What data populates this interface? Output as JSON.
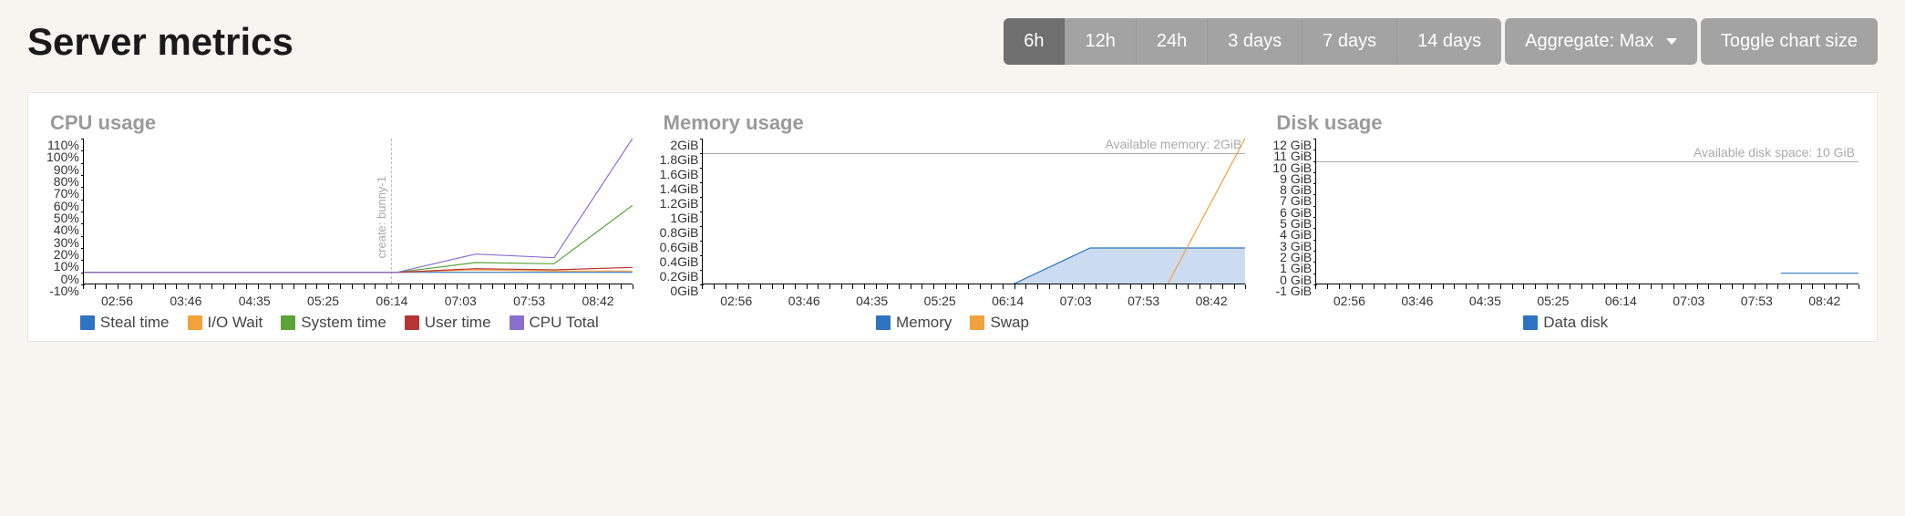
{
  "page_title": "Server metrics",
  "time_buttons": [
    "6h",
    "12h",
    "24h",
    "3 days",
    "7 days",
    "14 days"
  ],
  "time_active": "6h",
  "aggregate_label": "Aggregate: Max",
  "toggle_label": "Toggle chart size",
  "x_ticks": [
    "02:56",
    "03:46",
    "04:35",
    "05:25",
    "06:14",
    "07:03",
    "07:53",
    "08:42"
  ],
  "chart_data": [
    {
      "id": "cpu",
      "type": "line",
      "title": "CPU usage",
      "xlabel": "",
      "ylabel": "%",
      "ylim": [
        -10,
        110
      ],
      "y_ticks": [
        -10,
        0,
        10,
        20,
        30,
        40,
        50,
        60,
        70,
        80,
        90,
        100,
        110
      ],
      "y_tick_format": "%",
      "x": [
        "02:56",
        "03:46",
        "04:35",
        "05:25",
        "06:14",
        "07:03",
        "07:53",
        "08:42"
      ],
      "annotations": [
        {
          "type": "vline",
          "x": "06:30",
          "label": "create: bunny-1"
        }
      ],
      "series": [
        {
          "name": "Steal time",
          "color": "#2f74c2",
          "values": [
            0,
            0,
            0,
            0,
            0,
            0,
            0,
            0
          ]
        },
        {
          "name": "I/O Wait",
          "color": "#f2a13c",
          "values": [
            0,
            0,
            0,
            0,
            0,
            2,
            1,
            1
          ]
        },
        {
          "name": "System time",
          "color": "#5aa43a",
          "values": [
            0,
            0,
            0,
            0,
            0,
            8,
            7,
            55
          ]
        },
        {
          "name": "User time",
          "color": "#b83535",
          "values": [
            0,
            0,
            0,
            0,
            0,
            3,
            2,
            4
          ]
        },
        {
          "name": "CPU Total",
          "color": "#8b6fcf",
          "values": [
            0,
            0,
            0,
            0,
            0,
            15,
            12,
            110
          ]
        }
      ]
    },
    {
      "id": "mem",
      "type": "area",
      "title": "Memory usage",
      "xlabel": "",
      "ylabel": "GiB",
      "ylim": [
        0,
        2.0
      ],
      "y_ticks": [
        0,
        0.2,
        0.4,
        0.6,
        0.8,
        1.0,
        1.2,
        1.4,
        1.6,
        1.8,
        2.0
      ],
      "y_tick_format": "GiB",
      "x": [
        "02:56",
        "03:46",
        "04:35",
        "05:25",
        "06:14",
        "07:03",
        "07:53",
        "08:42"
      ],
      "annotations": [
        {
          "type": "hline",
          "y": 1.8,
          "label": "Available memory: 2GiB"
        }
      ],
      "series": [
        {
          "name": "Memory",
          "color": "#2f74c2",
          "fill": true,
          "values": [
            0,
            0,
            0,
            0,
            0,
            0.5,
            0.5,
            0.5
          ]
        },
        {
          "name": "Swap",
          "color": "#f2a13c",
          "fill": false,
          "values": [
            0,
            0,
            0,
            0,
            0,
            0,
            0,
            2.0
          ]
        }
      ]
    },
    {
      "id": "disk",
      "type": "line",
      "title": "Disk usage",
      "xlabel": "",
      "ylabel": "GiB",
      "ylim": [
        -1,
        12
      ],
      "y_ticks": [
        -1,
        0,
        1,
        2,
        3,
        4,
        5,
        6,
        7,
        8,
        9,
        10,
        11,
        12
      ],
      "y_tick_format": " GiB",
      "x": [
        "02:56",
        "03:46",
        "04:35",
        "05:25",
        "06:14",
        "07:03",
        "07:53",
        "08:42"
      ],
      "annotations": [
        {
          "type": "hline",
          "y": 10,
          "label": "Available disk space: 10 GiB"
        }
      ],
      "series": [
        {
          "name": "Data disk",
          "color": "#2f74c2",
          "values": [
            null,
            null,
            null,
            null,
            null,
            null,
            0,
            0
          ]
        }
      ]
    }
  ]
}
